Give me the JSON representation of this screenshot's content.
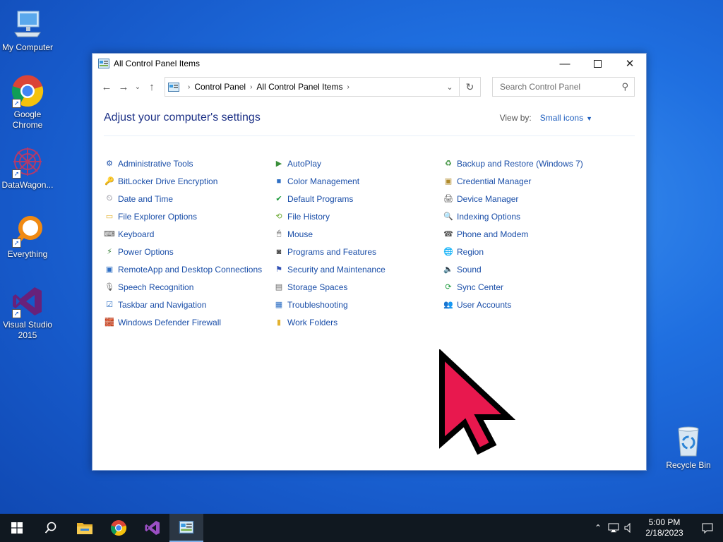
{
  "desktop": {
    "icons": [
      {
        "label": "My Computer"
      },
      {
        "label": "Google Chrome"
      },
      {
        "label": "DataWagon..."
      },
      {
        "label": "Everything"
      },
      {
        "label": "Visual Studio 2015"
      },
      {
        "label": "Recycle Bin"
      }
    ]
  },
  "window": {
    "title": "All Control Panel Items",
    "breadcrumb": [
      "Control Panel",
      "All Control Panel Items"
    ],
    "search_placeholder": "Search Control Panel",
    "heading": "Adjust your computer's settings",
    "view_by_label": "View by:",
    "view_by_value": "Small icons"
  },
  "items": {
    "col1": [
      {
        "label": "Administrative Tools",
        "icon": "tools-icon"
      },
      {
        "label": "BitLocker Drive Encryption",
        "icon": "bitlocker-icon"
      },
      {
        "label": "Date and Time",
        "icon": "clock-icon"
      },
      {
        "label": "File Explorer Options",
        "icon": "folder-options-icon"
      },
      {
        "label": "Keyboard",
        "icon": "keyboard-icon"
      },
      {
        "label": "Power Options",
        "icon": "power-icon"
      },
      {
        "label": "RemoteApp and Desktop Connections",
        "icon": "remoteapp-icon"
      },
      {
        "label": "Speech Recognition",
        "icon": "microphone-icon"
      },
      {
        "label": "Taskbar and Navigation",
        "icon": "taskbar-icon"
      },
      {
        "label": "Windows Defender Firewall",
        "icon": "firewall-icon"
      }
    ],
    "col2": [
      {
        "label": "AutoPlay",
        "icon": "autoplay-icon"
      },
      {
        "label": "Color Management",
        "icon": "color-icon"
      },
      {
        "label": "Default Programs",
        "icon": "default-programs-icon"
      },
      {
        "label": "File History",
        "icon": "file-history-icon"
      },
      {
        "label": "Mouse",
        "icon": "mouse-icon"
      },
      {
        "label": "Programs and Features",
        "icon": "programs-icon"
      },
      {
        "label": "Security and Maintenance",
        "icon": "flag-icon"
      },
      {
        "label": "Storage Spaces",
        "icon": "storage-icon"
      },
      {
        "label": "Troubleshooting",
        "icon": "troubleshoot-icon"
      },
      {
        "label": "Work Folders",
        "icon": "work-folders-icon"
      }
    ],
    "col3": [
      {
        "label": "Backup and Restore (Windows 7)",
        "icon": "backup-icon"
      },
      {
        "label": "Credential Manager",
        "icon": "credential-icon"
      },
      {
        "label": "Device Manager",
        "icon": "device-manager-icon"
      },
      {
        "label": "Indexing Options",
        "icon": "indexing-icon"
      },
      {
        "label": "Phone and Modem",
        "icon": "phone-icon"
      },
      {
        "label": "Region",
        "icon": "globe-icon"
      },
      {
        "label": "Sound",
        "icon": "speaker-icon"
      },
      {
        "label": "Sync Center",
        "icon": "sync-icon"
      },
      {
        "label": "User Accounts",
        "icon": "users-icon"
      }
    ]
  },
  "taskbar": {
    "time": "5:00 PM",
    "date": "2/18/2023"
  }
}
